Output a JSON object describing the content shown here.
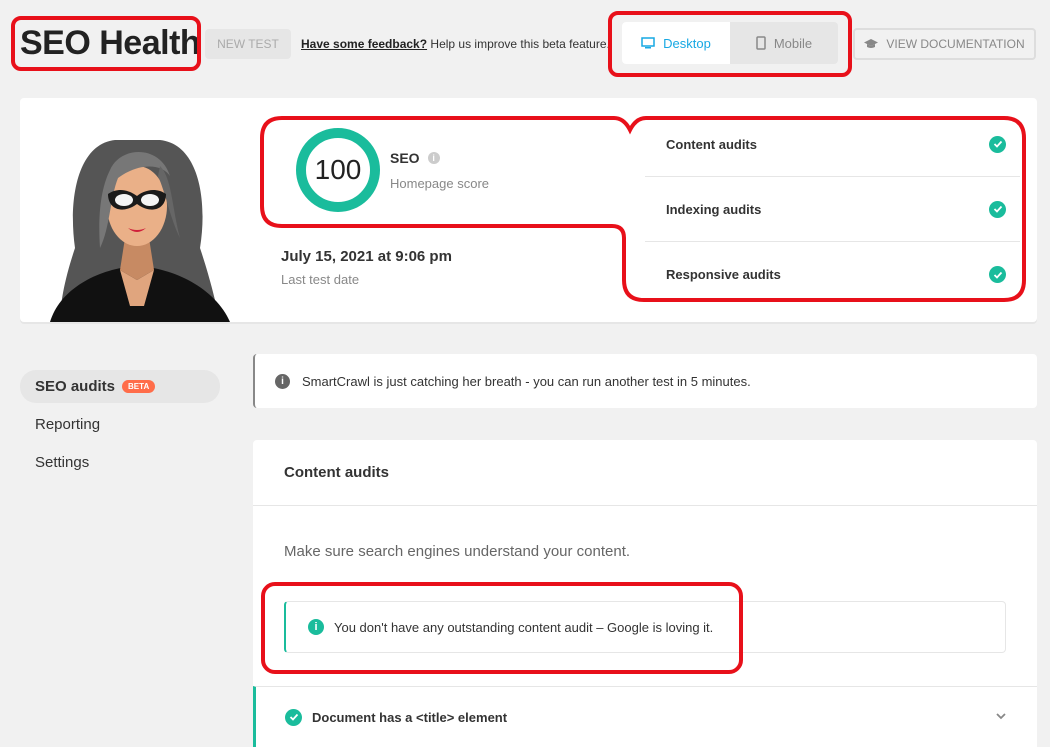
{
  "header": {
    "title": "SEO Health",
    "new_test": "NEW TEST",
    "feedback_link": "Have some feedback?",
    "feedback_text": " Help us improve this beta feature.",
    "device": {
      "desktop": "Desktop",
      "mobile": "Mobile",
      "selected": "Desktop"
    },
    "docs_button": "VIEW DOCUMENTATION"
  },
  "summary": {
    "score": "100",
    "score_label": "SEO",
    "score_sub": "Homepage score",
    "date": "July 15, 2021 at 9:06 pm",
    "date_sub": "Last test date",
    "audits": [
      {
        "label": "Content audits",
        "status": "passed"
      },
      {
        "label": "Indexing audits",
        "status": "passed"
      },
      {
        "label": "Responsive audits",
        "status": "passed"
      }
    ]
  },
  "nav": {
    "items": [
      {
        "label": "SEO audits",
        "badge": "BETA",
        "active": true
      },
      {
        "label": "Reporting"
      },
      {
        "label": "Settings"
      }
    ]
  },
  "notice": "SmartCrawl is just catching her breath - you can run another test in 5 minutes.",
  "content_audits": {
    "title": "Content audits",
    "description": "Make sure search engines understand your content.",
    "success_message": "You don't have any outstanding content audit – Google is loving it.",
    "items": [
      {
        "label": "Document has a <title> element",
        "status": "passed"
      }
    ]
  },
  "colors": {
    "accent": "#17a8e3",
    "success": "#1abc9c",
    "highlight": "#e8101a",
    "beta": "#ff6d4a"
  }
}
